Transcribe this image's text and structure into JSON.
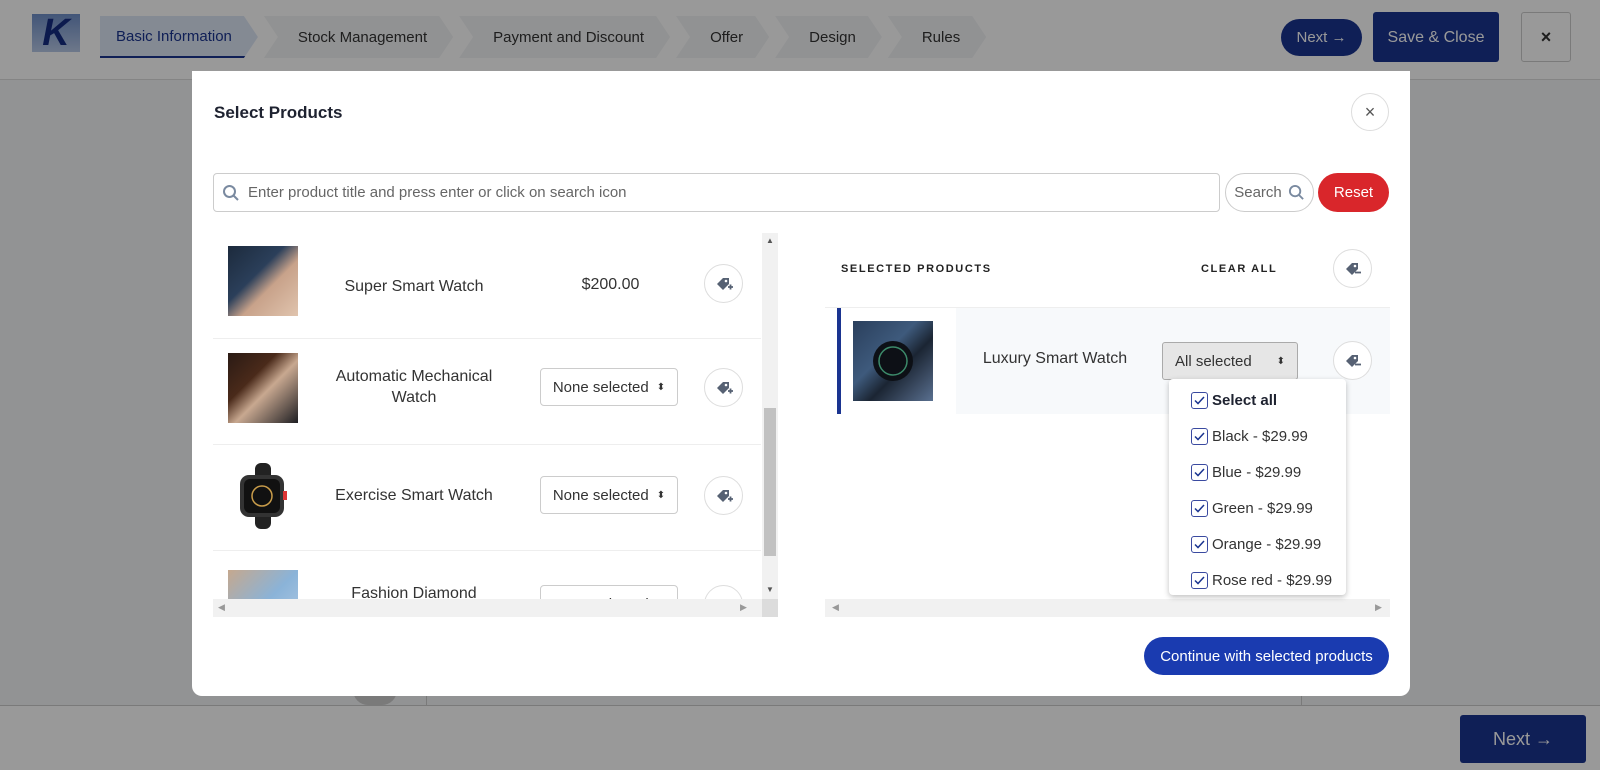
{
  "app": {
    "logo_letter": "K",
    "steps": [
      {
        "label": "Basic Information",
        "active": true
      },
      {
        "label": "Stock Management",
        "active": false
      },
      {
        "label": "Payment and Discount",
        "active": false
      },
      {
        "label": "Offer",
        "active": false
      },
      {
        "label": "Design",
        "active": false
      },
      {
        "label": "Rules",
        "active": false
      }
    ],
    "next_top_label": "Next →",
    "save_close_label": "Save & Close",
    "close_label": "×",
    "next_bottom_label": "Next →",
    "brand_color": "#1a3490"
  },
  "modal": {
    "title": "Select Products",
    "close_label": "×",
    "search": {
      "placeholder": "Enter product title and press enter or click on search icon",
      "value": "",
      "search_button_label": "Search",
      "reset_button_label": "Reset"
    },
    "products": [
      {
        "name": "Super Smart Watch",
        "price": "$200.00",
        "variant_select": null
      },
      {
        "name": "Automatic Mechanical Watch",
        "price": null,
        "variant_select": "None selected"
      },
      {
        "name": "Exercise Smart Watch",
        "price": null,
        "variant_select": "None selected"
      },
      {
        "name": "Fashion Diamond Women's",
        "price": null,
        "variant_select": "None selected"
      }
    ],
    "selected": {
      "header": "SELECTED PRODUCTS",
      "clear_all_label": "CLEAR ALL",
      "items": [
        {
          "name": "Luxury Smart Watch",
          "variant_select": "All selected"
        }
      ],
      "dropdown_options": [
        {
          "label": "Select all",
          "checked": true,
          "bold": true
        },
        {
          "label": "Black - $29.99",
          "checked": true
        },
        {
          "label": "Blue - $29.99",
          "checked": true
        },
        {
          "label": "Green - $29.99",
          "checked": true
        },
        {
          "label": "Orange - $29.99",
          "checked": true
        },
        {
          "label": "Rose red - $29.99",
          "checked": true
        }
      ]
    },
    "continue_label": "Continue with selected products",
    "reset_color": "#d9262b",
    "accent_color": "#1a3bb0"
  }
}
